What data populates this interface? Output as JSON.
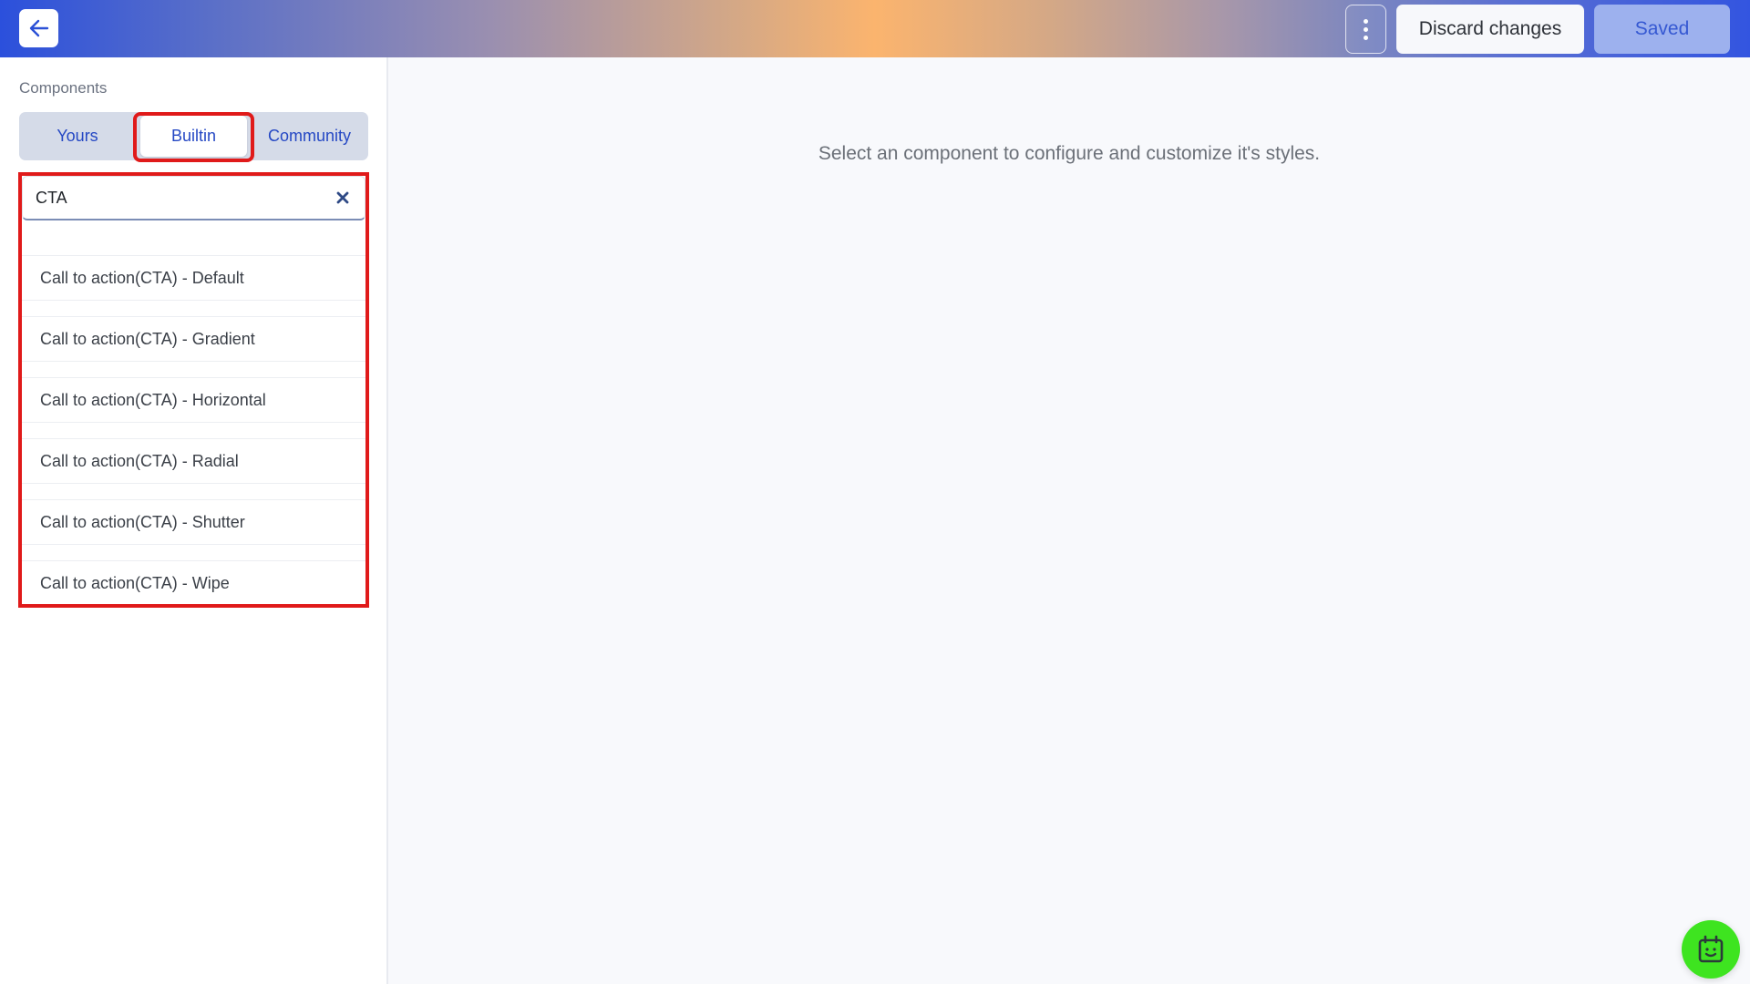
{
  "header": {
    "back_icon": "arrow-left-icon",
    "more_icon": "kebab-vertical-icon",
    "discard_label": "Discard changes",
    "saved_label": "Saved"
  },
  "sidebar": {
    "section_label": "Components",
    "tabs": [
      {
        "label": "Yours",
        "active": false
      },
      {
        "label": "Builtin",
        "active": true
      },
      {
        "label": "Community",
        "active": false
      }
    ],
    "search": {
      "value": "CTA",
      "clear_icon": "close-icon"
    },
    "results": [
      {
        "label": "Call to action(CTA) - Default"
      },
      {
        "label": "Call to action(CTA) - Gradient"
      },
      {
        "label": "Call to action(CTA) - Horizontal"
      },
      {
        "label": "Call to action(CTA) - Radial"
      },
      {
        "label": "Call to action(CTA) - Shutter"
      },
      {
        "label": "Call to action(CTA) - Wipe"
      }
    ]
  },
  "main": {
    "hint": "Select an component to configure and customize it's styles."
  },
  "fab": {
    "icon": "calendar-smile-icon"
  },
  "colors": {
    "accent": "#2548c4",
    "highlight": "#e01a1a",
    "fab": "#3ee420",
    "saved_bg": "#9db1ee"
  }
}
